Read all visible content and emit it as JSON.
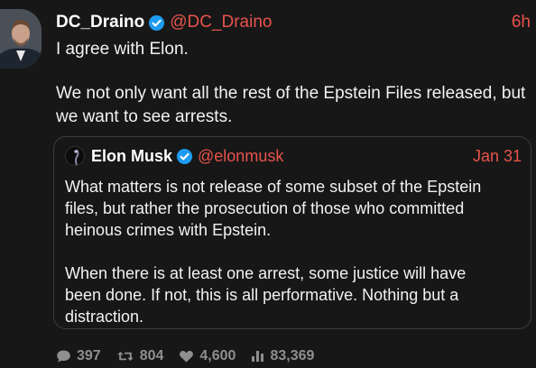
{
  "post": {
    "author": {
      "name": "DC_Draino",
      "handle": "@DC_Draino",
      "verified": true
    },
    "time": "6h",
    "text_lines": [
      "I agree with Elon.",
      "We not only want all the rest of the Epstein Files released, but",
      "we want to see arrests."
    ]
  },
  "quoted": {
    "author": {
      "name": "Elon Musk",
      "handle": "@elonmusk",
      "verified": true
    },
    "date": "Jan 31",
    "text_lines": [
      "What matters is not release of some subset of the Epstein",
      "files, but rather the prosecution of those who committed",
      "heinous crimes with Epstein.",
      "When there is at least one arrest, some justice will have",
      "been done. If not, this is all performative. Nothing but a",
      "distraction."
    ]
  },
  "stats": {
    "replies": "397",
    "reposts": "804",
    "likes": "4,600",
    "views": "83,369"
  },
  "colors": {
    "background": "#171717",
    "accent": "#e8534b",
    "verified_badge": "#1d9bf0",
    "muted": "#8f8f8f"
  },
  "icons": [
    "verified-badge-icon",
    "reply-icon",
    "repost-icon",
    "like-icon",
    "views-icon"
  ]
}
